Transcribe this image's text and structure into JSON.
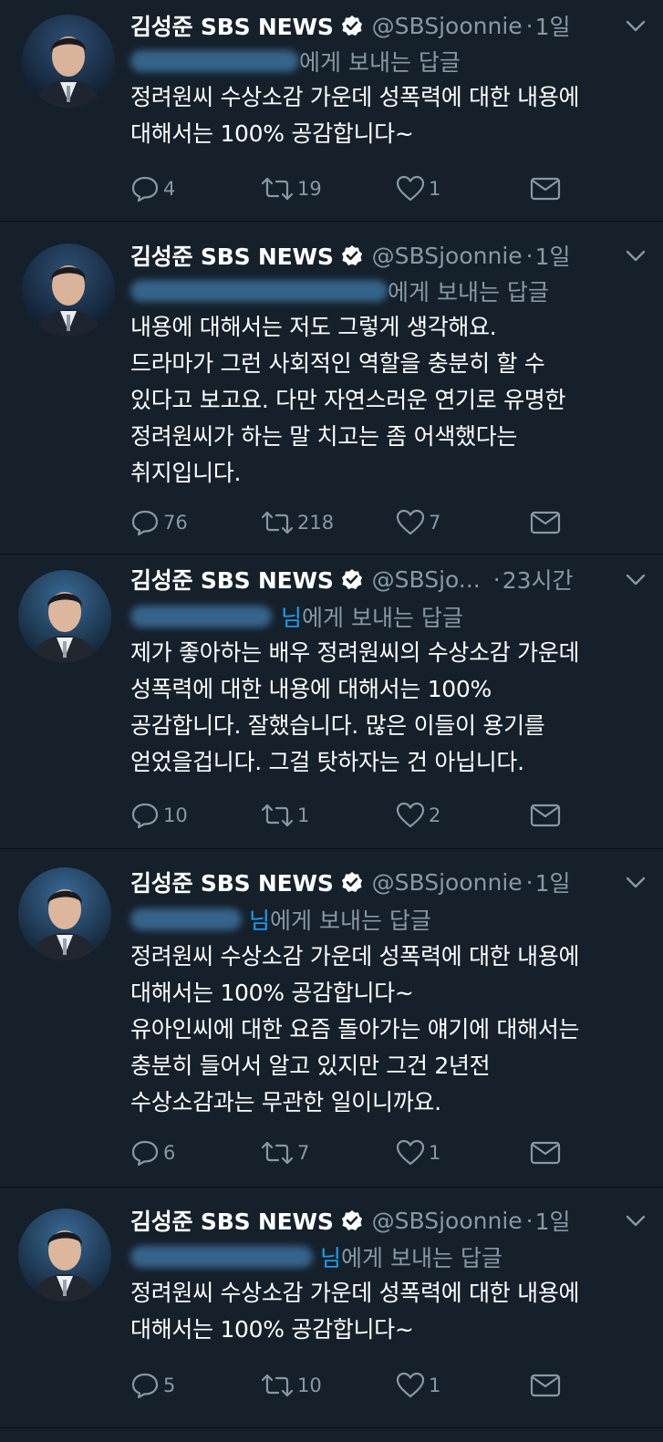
{
  "tweets": [
    {
      "name": "김성준 SBS NEWS",
      "handle": "@SBSjoonnie",
      "dot": "·",
      "time": "1일",
      "reply_suffix": "에게 보내는 답글",
      "nim": "",
      "lines": [
        "정려원씨 수상소감 가운데 성폭력에 대한 내용에",
        "대해서는 100% 공감합니다~"
      ],
      "replies": "4",
      "retweets": "19",
      "likes": "1"
    },
    {
      "name": "김성준 SBS NEWS",
      "handle": "@SBSjoonnie",
      "dot": "·",
      "time": "1일",
      "reply_suffix": "에게 보내는 답글",
      "nim": "",
      "lines": [
        "내용에 대해서는 저도 그렇게 생각해요.",
        "드라마가 그런 사회적인 역할을 충분히 할 수",
        "있다고 보고요. 다만 자연스러운 연기로 유명한",
        "정려원씨가 하는 말 치고는 좀 어색했다는",
        "취지입니다."
      ],
      "replies": "76",
      "retweets": "218",
      "likes": "7"
    },
    {
      "name": "김성준 SBS NEWS",
      "handle": "@SBSjo...",
      "dot": "·",
      "time": "23시간",
      "reply_suffix": "에게 보내는 답글",
      "nim": "님",
      "lines": [
        "제가 좋아하는 배우 정려원씨의 수상소감 가운데",
        "성폭력에 대한 내용에 대해서는 100%",
        "공감합니다. 잘했습니다. 많은 이들이 용기를",
        "얻었을겁니다. 그걸 탓하자는 건 아닙니다."
      ],
      "replies": "10",
      "retweets": "1",
      "likes": "2"
    },
    {
      "name": "김성준 SBS NEWS",
      "handle": "@SBSjoonnie",
      "dot": "·",
      "time": "1일",
      "reply_suffix": "에게 보내는 답글",
      "nim": "님",
      "lines": [
        "정려원씨 수상소감 가운데 성폭력에 대한 내용에",
        "대해서는 100% 공감합니다~",
        "유아인씨에 대한 요즘 돌아가는 얘기에 대해서는",
        "충분히 들어서 알고 있지만 그건 2년전",
        "수상소감과는 무관한 일이니까요."
      ],
      "replies": "6",
      "retweets": "7",
      "likes": "1"
    },
    {
      "name": "김성준 SBS NEWS",
      "handle": "@SBSjoonnie",
      "dot": "·",
      "time": "1일",
      "reply_suffix": "에게 보내는 답글",
      "nim": "님",
      "lines": [
        "정려원씨 수상소감 가운데 성폭력에 대한 내용에",
        "대해서는 100% 공감합니다~"
      ],
      "replies": "5",
      "retweets": "10",
      "likes": "1"
    }
  ],
  "icons": {
    "reply": "reply-icon",
    "retweet": "retweet-icon",
    "like": "heart-icon",
    "dm": "envelope-icon",
    "verified": "verified-badge-icon",
    "more": "chevron-down-icon"
  },
  "colors": {
    "background": "#15202b",
    "text": "#ffffff",
    "muted": "#8899a6",
    "link": "#1da1f2",
    "separator": "#0b1016"
  }
}
